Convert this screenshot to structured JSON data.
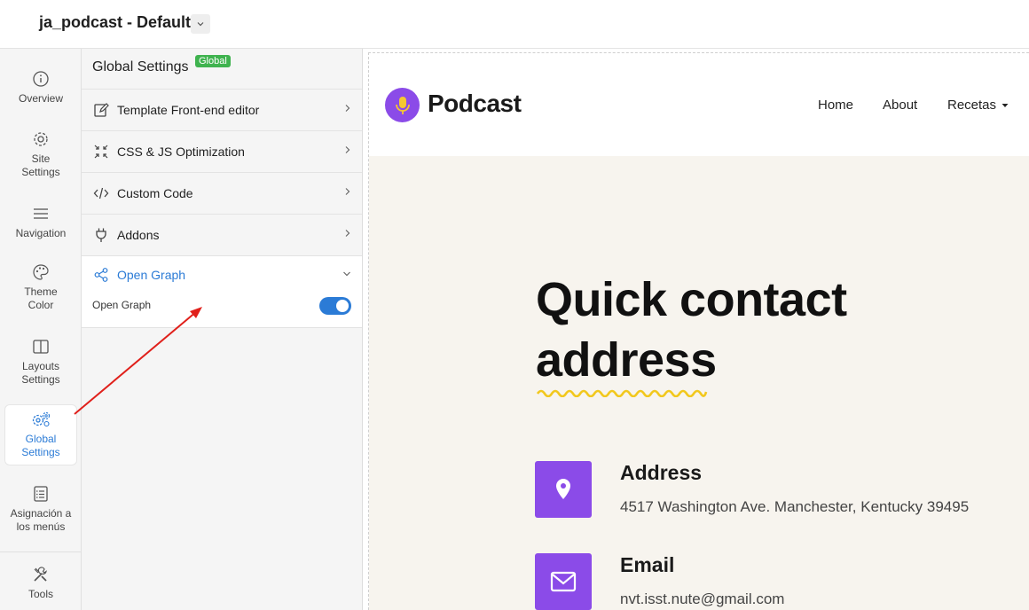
{
  "topbar": {
    "title": "ja_podcast - Default"
  },
  "rail": {
    "items": [
      {
        "label": "Overview",
        "icon": "info-icon"
      },
      {
        "label": "Site Settings",
        "icon": "gear-icon"
      },
      {
        "label": "Navigation",
        "icon": "menu-icon"
      },
      {
        "label": "Theme Color",
        "icon": "palette-icon"
      },
      {
        "label": "Layouts Settings",
        "icon": "layout-icon"
      },
      {
        "label": "Global Settings",
        "icon": "gears-icon",
        "active": true
      },
      {
        "label": "Asignación a los menús",
        "icon": "list-icon"
      },
      {
        "label": "Tools",
        "icon": "tools-icon"
      }
    ]
  },
  "panel": {
    "title": "Global Settings",
    "badge": "Global",
    "items": [
      {
        "label": "Template Front-end editor",
        "icon": "edit-icon"
      },
      {
        "label": "CSS & JS Optimization",
        "icon": "compress-icon"
      },
      {
        "label": "Custom Code",
        "icon": "code-icon"
      },
      {
        "label": "Addons",
        "icon": "plug-icon"
      }
    ],
    "open_graph": {
      "title": "Open Graph",
      "toggle_label": "Open Graph",
      "toggle_on": true
    }
  },
  "preview": {
    "logo": "Podcast",
    "nav": [
      "Home",
      "About",
      "Recetas"
    ],
    "hero_line1": "Quick contact",
    "hero_line2": "address",
    "address": {
      "title": "Address",
      "text": "4517 Washington Ave. Manchester, Kentucky 39495"
    },
    "email": {
      "title": "Email",
      "text": "nvt.isst.nute@gmail.com"
    }
  },
  "colors": {
    "accent": "#2b7bd6",
    "brand": "#8b4be8",
    "badge": "#3fb34f",
    "arrow": "#e0201b"
  }
}
